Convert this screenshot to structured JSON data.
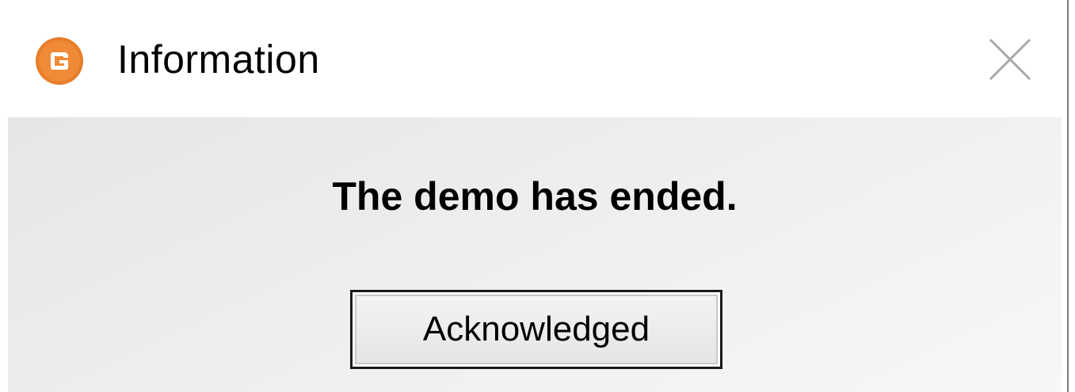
{
  "window": {
    "title": "Information",
    "app_icon": "orange-circle-g-icon",
    "close_icon": "close-x-icon"
  },
  "dialog": {
    "message": "The demo has ended.",
    "button_label": "Acknowledged"
  },
  "colors": {
    "icon_orange": "#e87d2a",
    "title_background": "#ffffff",
    "content_background": "#ececec",
    "close_icon_color": "#a8a8a8"
  }
}
